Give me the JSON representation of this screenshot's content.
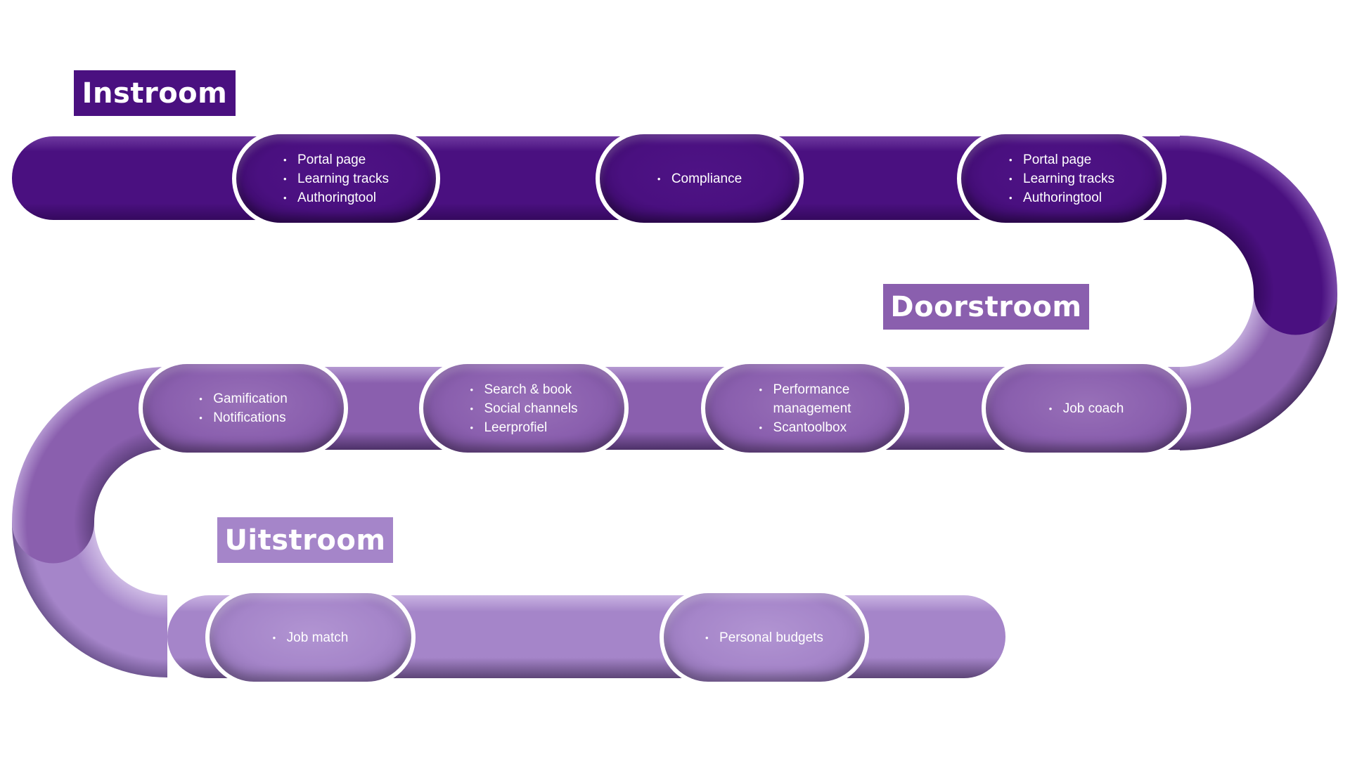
{
  "colors": {
    "instroom": "#4a1080",
    "doorstroom": "#8a5fae",
    "uitstroom": "#a585c9",
    "pill_border": "#ffffff",
    "text": "#ffffff"
  },
  "stages": [
    {
      "label": "Instroom",
      "pills": [
        {
          "items": [
            "Portal page",
            "Learning tracks",
            "Authoringtool"
          ]
        },
        {
          "items": [
            "Compliance"
          ]
        },
        {
          "items": [
            "Portal page",
            "Learning tracks",
            "Authoringtool"
          ]
        }
      ]
    },
    {
      "label": "Doorstroom",
      "pills": [
        {
          "items": [
            "Gamification",
            "Notifications"
          ]
        },
        {
          "items": [
            "Search & book",
            "Social channels",
            "Leerprofiel"
          ]
        },
        {
          "items": [
            "Performance",
            "management",
            "Scantoolbox"
          ]
        },
        {
          "items": [
            "Job coach"
          ]
        }
      ]
    },
    {
      "label": "Uitstroom",
      "pills": [
        {
          "items": [
            "Job match"
          ]
        },
        {
          "items": [
            "Personal budgets"
          ]
        }
      ]
    }
  ]
}
